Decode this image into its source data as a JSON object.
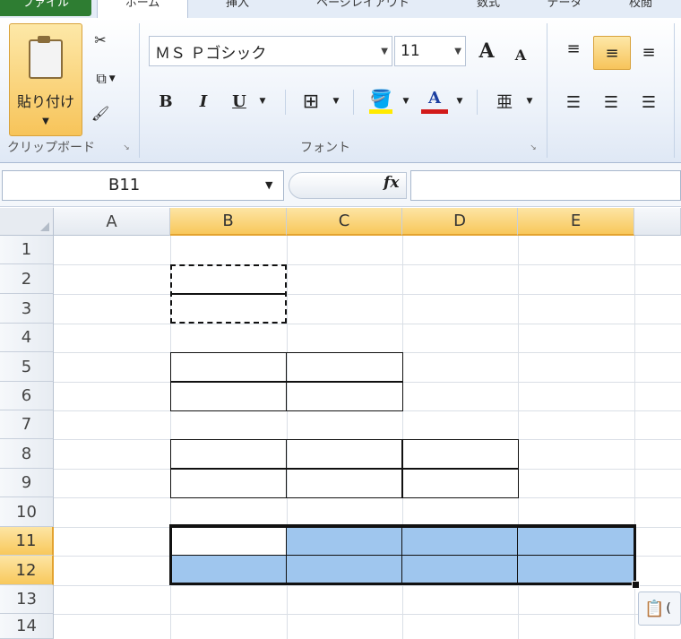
{
  "tabs": [
    "ファイル",
    "ホーム",
    "挿入",
    "ページレイアウト",
    "数式",
    "データ",
    "校閲"
  ],
  "ribbon": {
    "clipboard": {
      "paste_label": "貼り付け",
      "group_label": "クリップボード"
    },
    "font": {
      "font_name": "ＭＳ Ｐゴシック",
      "font_size": "11",
      "group_label": "フォント",
      "bold": "B",
      "italic": "I",
      "underline": "U",
      "grow": "A",
      "shrink": "A",
      "font_color": "A",
      "phonetic": "亜"
    }
  },
  "formula_bar": {
    "name_box": "B11",
    "fx": "fx",
    "formula": ""
  },
  "grid": {
    "columns": [
      "A",
      "B",
      "C",
      "D",
      "E"
    ],
    "rows": [
      "1",
      "2",
      "3",
      "4",
      "5",
      "6",
      "7",
      "8",
      "9",
      "10",
      "11",
      "12",
      "13",
      "14"
    ],
    "selected_columns": [
      "B",
      "C",
      "D",
      "E"
    ],
    "selected_rows": [
      "11",
      "12"
    ],
    "active_cell": "B11"
  },
  "colors": {
    "selection_fill": "#9fc6ee",
    "header_selected": "#f8c85b",
    "file_tab": "#2e7d32"
  }
}
